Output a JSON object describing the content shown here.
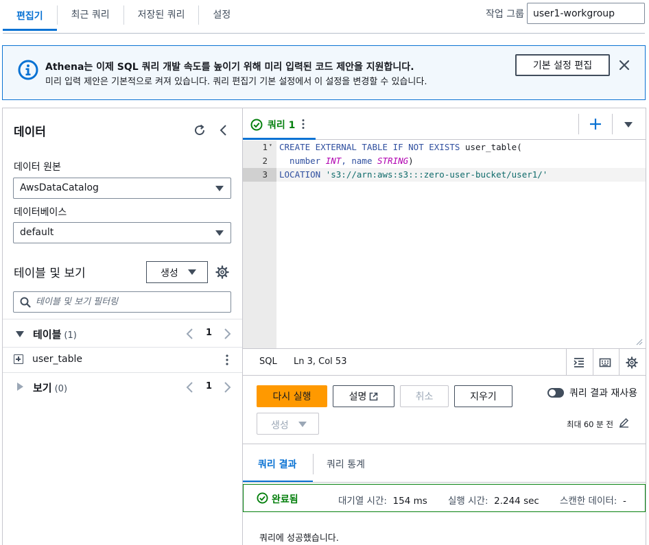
{
  "top_tabs": [
    "편집기",
    "최근 쿼리",
    "저장된 쿼리",
    "설정"
  ],
  "workgroup": {
    "label": "작업 그룹",
    "value": "user1-workgroup"
  },
  "banner": {
    "title": "Athena는 이제 SQL 쿼리 개발 속도를 높이기 위해 미리 입력된 코드 제안을 지원합니다.",
    "text": "미리 입력 제안은 기본적으로 켜져 있습니다. 쿼리 편집기 기본 설정에서 이 설정을 변경할 수 있습니다.",
    "button": "기본 설정 편집",
    "accent_color": "#0972d3",
    "icon": "info-icon"
  },
  "data_panel": {
    "title": "데이터",
    "source_label": "데이터 원본",
    "source_value": "AwsDataCatalog",
    "database_label": "데이터베이스",
    "database_value": "default",
    "tables_views_title": "테이블 및 보기",
    "create_button": "생성",
    "filter_placeholder": "테이블 및 보기 필터링",
    "tables": {
      "label": "테이블",
      "count": "(1)",
      "page": "1",
      "items": [
        "user_table"
      ]
    },
    "views": {
      "label": "보기",
      "count": "(0)",
      "page": "1"
    }
  },
  "query_tab": {
    "label": "쿼리 1",
    "status_color": "#037f0c"
  },
  "editor": {
    "lines": [
      {
        "num": "1",
        "tokens": [
          {
            "t": "CREATE EXTERNAL TABLE IF NOT EXISTS ",
            "c": "kw"
          },
          {
            "t": "user_table(",
            "c": "ident"
          }
        ]
      },
      {
        "num": "2",
        "tokens": [
          {
            "t": "  number ",
            "c": "kw"
          },
          {
            "t": "INT",
            "c": "typ"
          },
          {
            "t": ", name ",
            "c": "kw"
          },
          {
            "t": "STRING",
            "c": "typ"
          },
          {
            "t": ")",
            "c": "ident"
          }
        ]
      },
      {
        "num": "3",
        "tokens": [
          {
            "t": "LOCATION ",
            "c": "kw"
          },
          {
            "t": "'s3://arn:aws:s3:::zero-user-bucket/user1/'",
            "c": "str"
          }
        ]
      }
    ],
    "active_line": "3"
  },
  "status_bar": {
    "language": "SQL",
    "position": "Ln 3, Col 53"
  },
  "actions": {
    "run": "다시 실행",
    "explain": "설명",
    "cancel": "취소",
    "clear": "지우기",
    "generate": "생성",
    "reuse_label": "쿼리 결과 재사용",
    "reuse_enabled": false,
    "max_age": "최대 60 분 전",
    "run_color": "#ff9900"
  },
  "result_tabs": [
    "쿼리 결과",
    "쿼리 통계"
  ],
  "result": {
    "status": "완료됨",
    "queue_label": "대기열 시간:",
    "queue_value": "154 ms",
    "run_label": "실행 시간:",
    "run_value": "2.244 sec",
    "scanned_label": "스캔한 데이터:",
    "scanned_value": "-",
    "message": "쿼리에 성공했습니다."
  }
}
